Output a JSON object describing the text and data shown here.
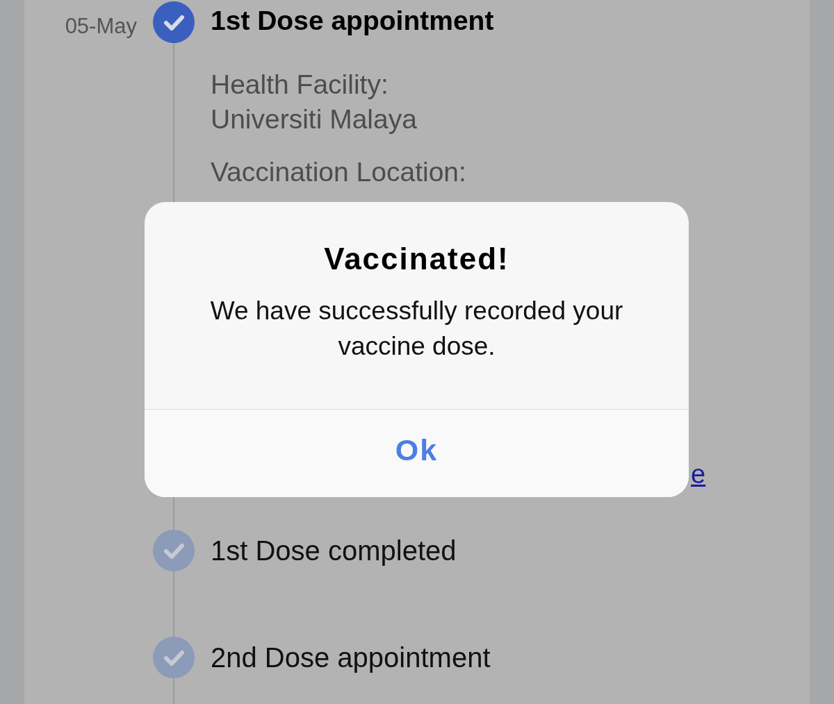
{
  "timeline": {
    "steps": [
      {
        "date": "05-May",
        "title": "1st Dose appointment",
        "active": true,
        "details": [
          {
            "label": "Health Facility:",
            "value": "Universiti Malaya"
          },
          {
            "label": "Vaccination Location:"
          }
        ],
        "link": "e"
      },
      {
        "title": "1st Dose completed",
        "active": false
      },
      {
        "title": "2nd Dose appointment",
        "active": false
      }
    ]
  },
  "dialog": {
    "title": "Vaccinated!",
    "message": "We have successfully recorded your vaccine dose.",
    "button": "Ok"
  }
}
